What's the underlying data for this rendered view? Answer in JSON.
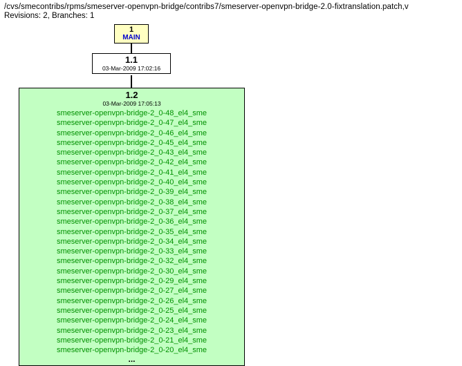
{
  "header": {
    "path": "/cvs/smecontribs/rpms/smeserver-openvpn-bridge/contribs7/smeserver-openvpn-bridge-2.0-fixtranslation.patch,v",
    "meta": "Revisions: 2, Branches: 1"
  },
  "nodes": {
    "main": {
      "num": "1",
      "label": "MAIN"
    },
    "v11": {
      "version": "1.1",
      "date": "03-Mar-2009 17:02:16"
    },
    "v12": {
      "version": "1.2",
      "date": "03-Mar-2009 17:05:13",
      "tags": [
        "smeserver-openvpn-bridge-2_0-48_el4_sme",
        "smeserver-openvpn-bridge-2_0-47_el4_sme",
        "smeserver-openvpn-bridge-2_0-46_el4_sme",
        "smeserver-openvpn-bridge-2_0-45_el4_sme",
        "smeserver-openvpn-bridge-2_0-43_el4_sme",
        "smeserver-openvpn-bridge-2_0-42_el4_sme",
        "smeserver-openvpn-bridge-2_0-41_el4_sme",
        "smeserver-openvpn-bridge-2_0-40_el4_sme",
        "smeserver-openvpn-bridge-2_0-39_el4_sme",
        "smeserver-openvpn-bridge-2_0-38_el4_sme",
        "smeserver-openvpn-bridge-2_0-37_el4_sme",
        "smeserver-openvpn-bridge-2_0-36_el4_sme",
        "smeserver-openvpn-bridge-2_0-35_el4_sme",
        "smeserver-openvpn-bridge-2_0-34_el4_sme",
        "smeserver-openvpn-bridge-2_0-33_el4_sme",
        "smeserver-openvpn-bridge-2_0-32_el4_sme",
        "smeserver-openvpn-bridge-2_0-30_el4_sme",
        "smeserver-openvpn-bridge-2_0-29_el4_sme",
        "smeserver-openvpn-bridge-2_0-27_el4_sme",
        "smeserver-openvpn-bridge-2_0-26_el4_sme",
        "smeserver-openvpn-bridge-2_0-25_el4_sme",
        "smeserver-openvpn-bridge-2_0-24_el4_sme",
        "smeserver-openvpn-bridge-2_0-23_el4_sme",
        "smeserver-openvpn-bridge-2_0-21_el4_sme",
        "smeserver-openvpn-bridge-2_0-20_el4_sme"
      ],
      "ellipsis": "..."
    }
  }
}
